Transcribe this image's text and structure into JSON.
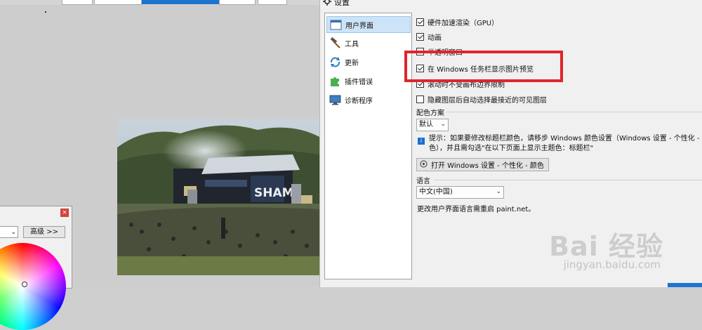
{
  "settings": {
    "title": "设置",
    "nav": [
      {
        "label": "用户界面",
        "icon": "window-icon",
        "selected": true
      },
      {
        "label": "工具",
        "icon": "hammer-icon",
        "selected": false
      },
      {
        "label": "更新",
        "icon": "refresh-icon",
        "selected": false
      },
      {
        "label": "插件错误",
        "icon": "puzzle-icon",
        "selected": false
      },
      {
        "label": "诊断程序",
        "icon": "monitor-icon",
        "selected": false
      }
    ],
    "options": [
      {
        "label": "硬件加速渲染（GPU）",
        "checked": true
      },
      {
        "label": "动画",
        "checked": true
      },
      {
        "label": "半透明窗口",
        "checked": false
      },
      {
        "label": "在 Windows 任务栏显示图片预览",
        "checked": true
      },
      {
        "label": "滚动时不受画布边界限制",
        "checked": true
      },
      {
        "label": "隐藏图层后自动选择最接近的可见图层",
        "checked": false
      }
    ],
    "color_scheme": {
      "label": "配色方案",
      "value": "默认",
      "hint_line1": "提示：如果要修改标题栏颜色，请移步 Windows 颜色设置（Windows 设置 - 个性化 - i",
      "hint_line2": "色），并且需勾选\"在以下页面上显示主题色：标题栏\"",
      "button_label": "打开 Windows 设置 - 个性化 - 颜色"
    },
    "language": {
      "label": "语言",
      "value": "中文(中国)",
      "note": "更改用户界面语言需重启 paint.net。"
    }
  },
  "color_window": {
    "advanced_label": "高级 >>",
    "select_value": "",
    "close_label": "×"
  },
  "watermark": {
    "text": "Bai 经验",
    "sub": "jingyan.baidu.com"
  },
  "colors": {
    "highlight": "#e0252b",
    "accent_blue": "#1c74d0",
    "selected_nav": "#cde3f7"
  }
}
